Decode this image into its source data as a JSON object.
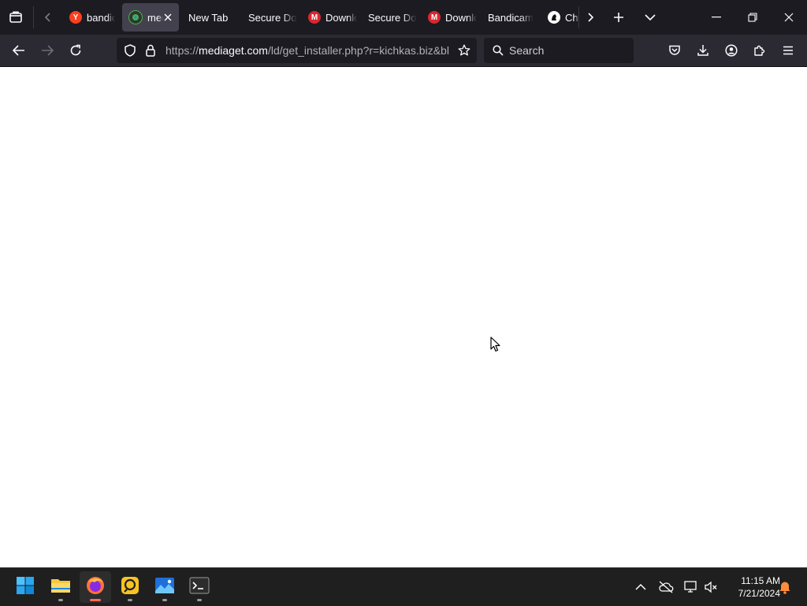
{
  "tabs": [
    {
      "label": "bandicam",
      "favicon": "yandex-icon",
      "active": false
    },
    {
      "label": "mediaget",
      "favicon": "mediaget-icon",
      "active": true
    },
    {
      "label": "New Tab",
      "favicon": "",
      "active": false
    },
    {
      "label": "Secure Download",
      "favicon": "",
      "active": false
    },
    {
      "label": "Download",
      "favicon": "mega-icon",
      "active": false
    },
    {
      "label": "Secure Download",
      "favicon": "",
      "active": false
    },
    {
      "label": "Download",
      "favicon": "mega-icon",
      "active": false
    },
    {
      "label": "Bandicam",
      "favicon": "",
      "active": false
    },
    {
      "label": "Chess",
      "favicon": "chess-icon",
      "active": false
    }
  ],
  "toolbar": {
    "url_scheme": "https://",
    "url_host": "mediaget.com",
    "url_path": "/ld/get_installer.php?r=kichkas.biz&bl",
    "search_placeholder": "Search"
  },
  "taskbar": {
    "apps": [
      "start-icon",
      "file-explorer-icon",
      "firefox-icon",
      "app-yellow-icon",
      "photos-icon",
      "terminal-icon"
    ],
    "active_app": "firefox-icon",
    "time": "11:15 AM",
    "date": "7/21/2024"
  },
  "colors": {
    "tabbar_bg": "#1c1b22",
    "toolbar_bg": "#2b2a33",
    "taskbar_bg": "#1f1f1f",
    "active_tab_bg": "#42414d",
    "yandex_red": "#fc3f1d",
    "mega_red": "#d9272e",
    "windows_blue": "#0078d4"
  }
}
